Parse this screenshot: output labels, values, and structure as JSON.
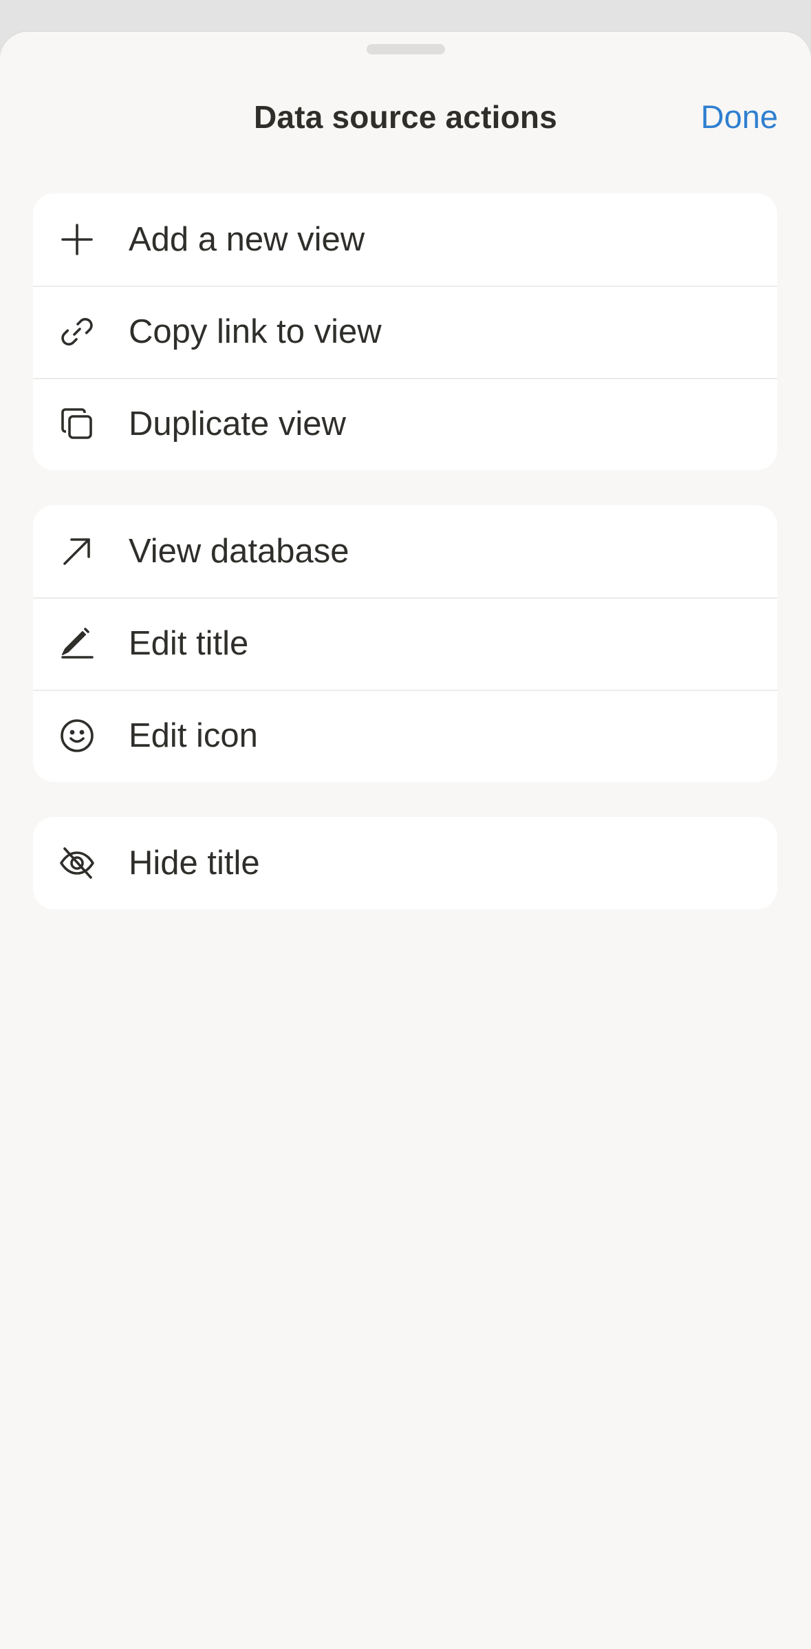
{
  "sheet": {
    "title": "Data source actions",
    "done_label": "Done"
  },
  "groups": [
    {
      "items": [
        {
          "label": "Add a new view",
          "icon": "plus-icon"
        },
        {
          "label": "Copy link to view",
          "icon": "link-icon"
        },
        {
          "label": "Duplicate view",
          "icon": "duplicate-icon"
        }
      ]
    },
    {
      "items": [
        {
          "label": "View database",
          "icon": "arrow-up-right-icon"
        },
        {
          "label": "Edit title",
          "icon": "pencil-icon"
        },
        {
          "label": "Edit icon",
          "icon": "smiley-icon"
        }
      ]
    },
    {
      "items": [
        {
          "label": "Hide title",
          "icon": "eye-off-icon"
        }
      ]
    }
  ],
  "colors": {
    "accent": "#2f7fd0",
    "sheet_background": "#f8f7f5",
    "card_background": "#ffffff",
    "text": "#2f2e2b"
  }
}
